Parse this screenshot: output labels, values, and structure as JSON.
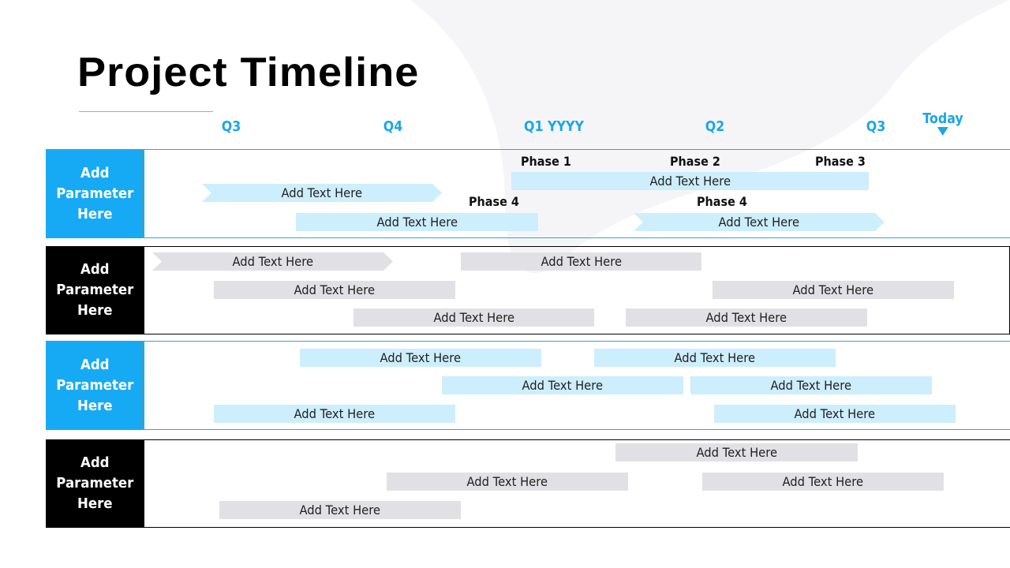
{
  "title": "Project Timeline",
  "timeline": {
    "quarters": [
      "Q3",
      "Q4",
      "Q1 YYYY",
      "Q2",
      "Q3"
    ],
    "today_label": "Today",
    "today_marker": "down-triangle-icon"
  },
  "colors": {
    "accent_blue": "#16aaf5",
    "quarter_text": "#1aa6e8",
    "light_blue_bar": "#cdeefc",
    "gray_bar": "#e1e1e5",
    "dark_label": "#000000"
  },
  "rows": [
    {
      "label": "Add Parameter Here",
      "style": "blue",
      "phases": [
        "Phase 1",
        "Phase 2",
        "Phase 3",
        "Phase 4",
        "Phase 4"
      ],
      "bars": [
        "Add Text Here",
        "Add Text Here",
        "Add Text Here",
        "Add Text Here"
      ]
    },
    {
      "label": "Add Parameter Here",
      "style": "black",
      "bars": [
        "Add Text Here",
        "Add Text Here",
        "Add Text Here",
        "Add Text Here",
        "Add Text Here",
        "Add Text Here"
      ]
    },
    {
      "label": "Add Parameter Here",
      "style": "blue",
      "bars": [
        "Add Text Here",
        "Add Text Here",
        "Add Text Here",
        "Add Text Here",
        "Add Text Here",
        "Add Text Here"
      ]
    },
    {
      "label": "Add Parameter Here",
      "style": "black",
      "bars": [
        "Add Text Here",
        "Add Text Here",
        "Add Text Here",
        "Add Text Here"
      ]
    }
  ]
}
